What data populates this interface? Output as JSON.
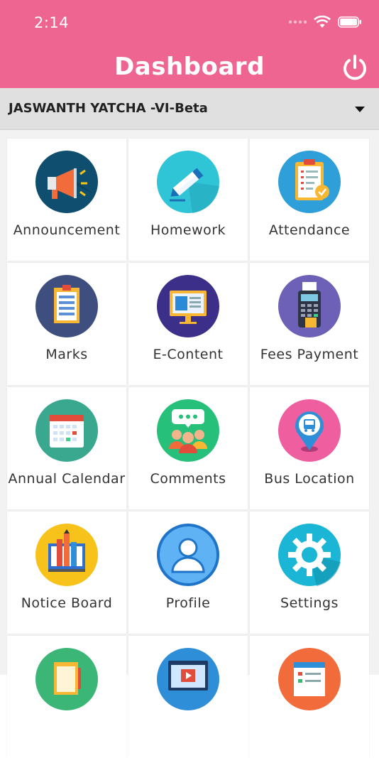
{
  "status": {
    "time": "2:14"
  },
  "header": {
    "title": "Dashboard"
  },
  "student_selector": {
    "value": "JASWANTH YATCHA -VI-Beta"
  },
  "tiles": [
    {
      "label": "Announcement",
      "icon": "megaphone-icon"
    },
    {
      "label": "Homework",
      "icon": "pencil-icon"
    },
    {
      "label": "Attendance",
      "icon": "clipboard-check-icon"
    },
    {
      "label": "Marks",
      "icon": "report-card-icon"
    },
    {
      "label": "E-Content",
      "icon": "monitor-icon"
    },
    {
      "label": "Fees Payment",
      "icon": "card-machine-icon"
    },
    {
      "label": "Annual Calendar",
      "icon": "calendar-icon"
    },
    {
      "label": "Comments",
      "icon": "group-chat-icon"
    },
    {
      "label": "Bus Location",
      "icon": "bus-pin-icon"
    },
    {
      "label": "Notice Board",
      "icon": "notice-board-icon"
    },
    {
      "label": "Profile",
      "icon": "user-icon"
    },
    {
      "label": "Settings",
      "icon": "gear-icon"
    },
    {
      "label": "",
      "icon": "notebook-icon"
    },
    {
      "label": "",
      "icon": "video-icon"
    },
    {
      "label": "",
      "icon": "document-icon"
    }
  ],
  "colors": {
    "brand": "#ef6592",
    "selector_bg": "#e0e0e0"
  }
}
